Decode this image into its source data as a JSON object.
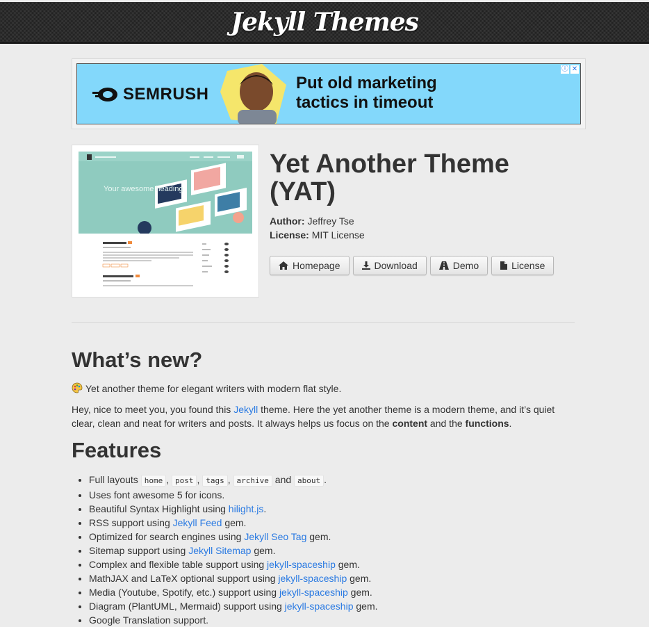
{
  "header": {
    "site_title": "Jekyll Themes"
  },
  "ad": {
    "brand": "SEMRUSH",
    "headline": "Put old marketing tactics in timeout",
    "colors": {
      "background": "#83d8fb",
      "accent": "#f5e66b"
    }
  },
  "theme": {
    "title": "Yet Another Theme (YAT)",
    "author_label": "Author:",
    "author": "Jeffrey Tse",
    "license_label": "License:",
    "license": "MIT License",
    "thumbnail": {
      "hero_text": "Your awesome heading",
      "post1_title": "Welcome to Jekyll!",
      "post2_title": "An exhibit of Markdown"
    },
    "buttons": {
      "homepage": "Homepage",
      "download": "Download",
      "demo": "Demo",
      "license": "License"
    }
  },
  "whats_new": {
    "heading": "What’s new?",
    "emoji": "palette-icon",
    "intro": "Yet another theme for elegant writers with modern flat style.",
    "p1": "Hey, nice to meet you, you found this ",
    "p1_link": "Jekyll",
    "p2": " theme. Here the yet another theme is a modern theme, and it’s quiet clear, clean and neat for writers and posts. It always helps us focus on the ",
    "p2_bold1": "content",
    "p3": " and the ",
    "p3_bold2": "functions",
    "p4": "."
  },
  "features": {
    "heading": "Features",
    "layouts_prefix": "Full layouts ",
    "layouts": [
      "home",
      "post",
      "tags",
      "archive",
      "about"
    ],
    "layouts_and": " and ",
    "items": [
      {
        "pre": "Uses font awesome 5 for icons.",
        "link": "",
        "post": ""
      },
      {
        "pre": "Beautiful Syntax Highlight using ",
        "link": "hilight.js",
        "post": "."
      },
      {
        "pre": "RSS support using ",
        "link": "Jekyll Feed",
        "post": " gem."
      },
      {
        "pre": "Optimized for search engines using ",
        "link": "Jekyll Seo Tag",
        "post": " gem."
      },
      {
        "pre": "Sitemap support using ",
        "link": "Jekyll Sitemap",
        "post": " gem."
      },
      {
        "pre": "Complex and flexible table support using ",
        "link": "jekyll-spaceship",
        "post": " gem."
      },
      {
        "pre": "MathJAX and LaTeX optional support using ",
        "link": "jekyll-spaceship",
        "post": " gem."
      },
      {
        "pre": "Media (Youtube, Spotify, etc.) support using ",
        "link": "jekyll-spaceship",
        "post": " gem."
      },
      {
        "pre": "Diagram (PlantUML, Mermaid) support using ",
        "link": "jekyll-spaceship",
        "post": " gem."
      },
      {
        "pre": "Google Translation support.",
        "link": "",
        "post": ""
      }
    ]
  }
}
